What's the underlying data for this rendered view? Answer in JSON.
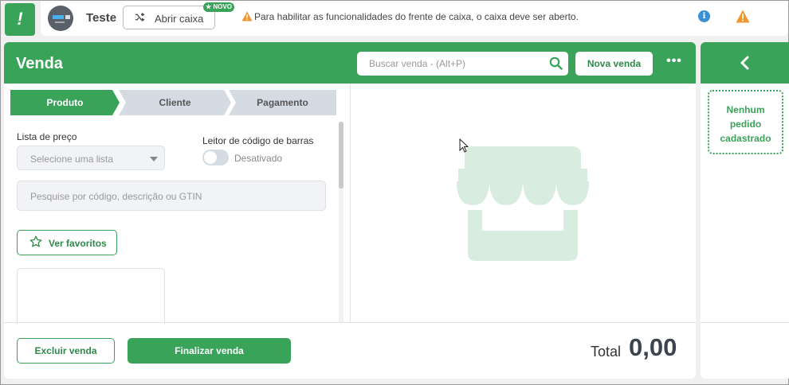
{
  "topbar": {
    "logo": "!",
    "store_name": "Teste",
    "open_box_label": "Abrir caixa",
    "novo_badge": "★ NOVO",
    "warning": "Para habilitar as funcionalidades do frente de caixa, o caixa deve ser aberto.",
    "info_icon": "info-icon",
    "alert_icon": "warning-icon"
  },
  "venda": {
    "title": "Venda",
    "search_placeholder": "Buscar venda - (Alt+P)",
    "new_sale_label": "Nova venda",
    "more_label": "•••",
    "steps": [
      "Produto",
      "Cliente",
      "Pagamento"
    ],
    "price_list_label": "Lista de preço",
    "price_list_value": "Selecione uma lista",
    "barcode_label": "Leitor de código de barras",
    "barcode_state": "Desativado",
    "product_search_placeholder": "Pesquise por código, descrição ou GTIN",
    "favorites_label": "Ver favoritos",
    "delete_label": "Excluir venda",
    "finish_label": "Finalizar venda",
    "total_label": "Total",
    "total_value": "0,00"
  },
  "orders": {
    "empty_line1": "Nenhum",
    "empty_line2": "pedido",
    "empty_line3": "cadastrado"
  },
  "colors": {
    "accent": "#3aa35a",
    "step_inactive": "#d5dbe3",
    "illustration": "#d8eddf"
  }
}
